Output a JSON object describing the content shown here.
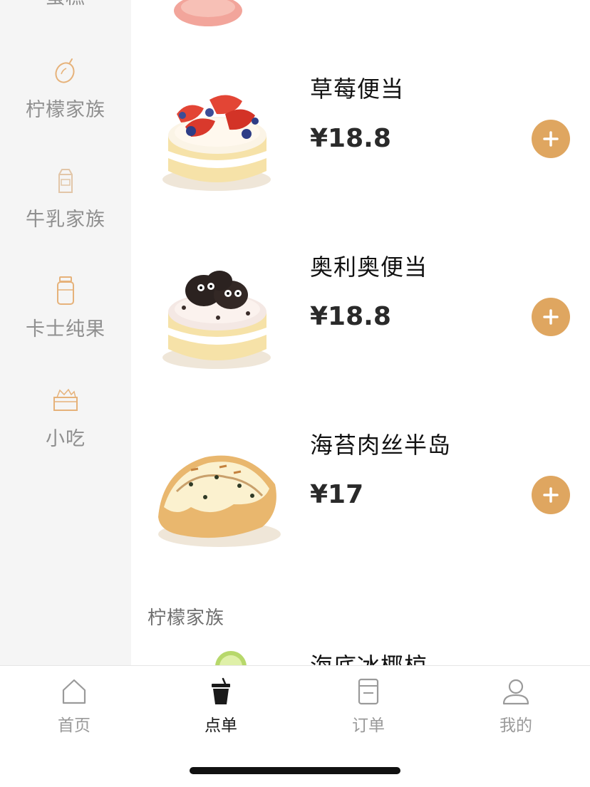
{
  "sidebar": {
    "items": [
      {
        "label": "蛋糕",
        "icon": "cake-icon"
      },
      {
        "label": "柠檬家族",
        "icon": "lemon-icon"
      },
      {
        "label": "牛乳家族",
        "icon": "milk-carton-icon"
      },
      {
        "label": "卡士纯果",
        "icon": "jar-icon"
      },
      {
        "label": "小吃",
        "icon": "snack-box-icon"
      }
    ]
  },
  "products": [
    {
      "name": "草莓便当",
      "price": "¥18.8",
      "image": "strawberry-cake"
    },
    {
      "name": "奥利奥便当",
      "price": "¥18.8",
      "image": "oreo-cake"
    },
    {
      "name": "海苔肉丝半岛",
      "price": "¥17",
      "image": "seaweed-bread"
    }
  ],
  "section": {
    "title": "柠檬家族",
    "next_product_name": "海底冰椰椋"
  },
  "tabbar": {
    "tabs": [
      {
        "label": "首页",
        "icon": "home-icon"
      },
      {
        "label": "点单",
        "icon": "drink-cup-icon",
        "active": true
      },
      {
        "label": "订单",
        "icon": "order-icon"
      },
      {
        "label": "我的",
        "icon": "user-icon"
      }
    ]
  },
  "colors": {
    "accent": "#dfa660",
    "sidebar_bg": "#f5f5f5",
    "inactive_text": "#9a9a9a"
  }
}
